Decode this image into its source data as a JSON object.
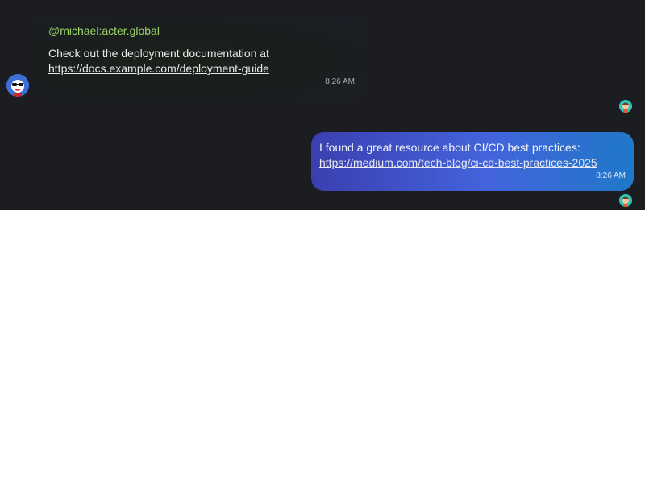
{
  "messages": {
    "incoming": {
      "sender": "@michael:acter.global",
      "text": "Check out the deployment documentation at ",
      "link": "https://docs.example.com/deployment-guide",
      "time": "8:26 AM",
      "avatar_icon": "sunglasses-avatar-icon"
    },
    "outgoing": {
      "text": "I found a great resource about CI/CD best practices: ",
      "link": "https://medium.com/tech-blog/ci-cd-best-practices-2025",
      "time": "8:26 AM",
      "read_receipt_icon": "user-avatar-icon"
    }
  },
  "colors": {
    "chat_background": "#1b1d21",
    "sender_name": "#9cd46c",
    "outgoing_bubble_start": "#3b3fb0",
    "outgoing_bubble_end": "#1f78c8"
  }
}
